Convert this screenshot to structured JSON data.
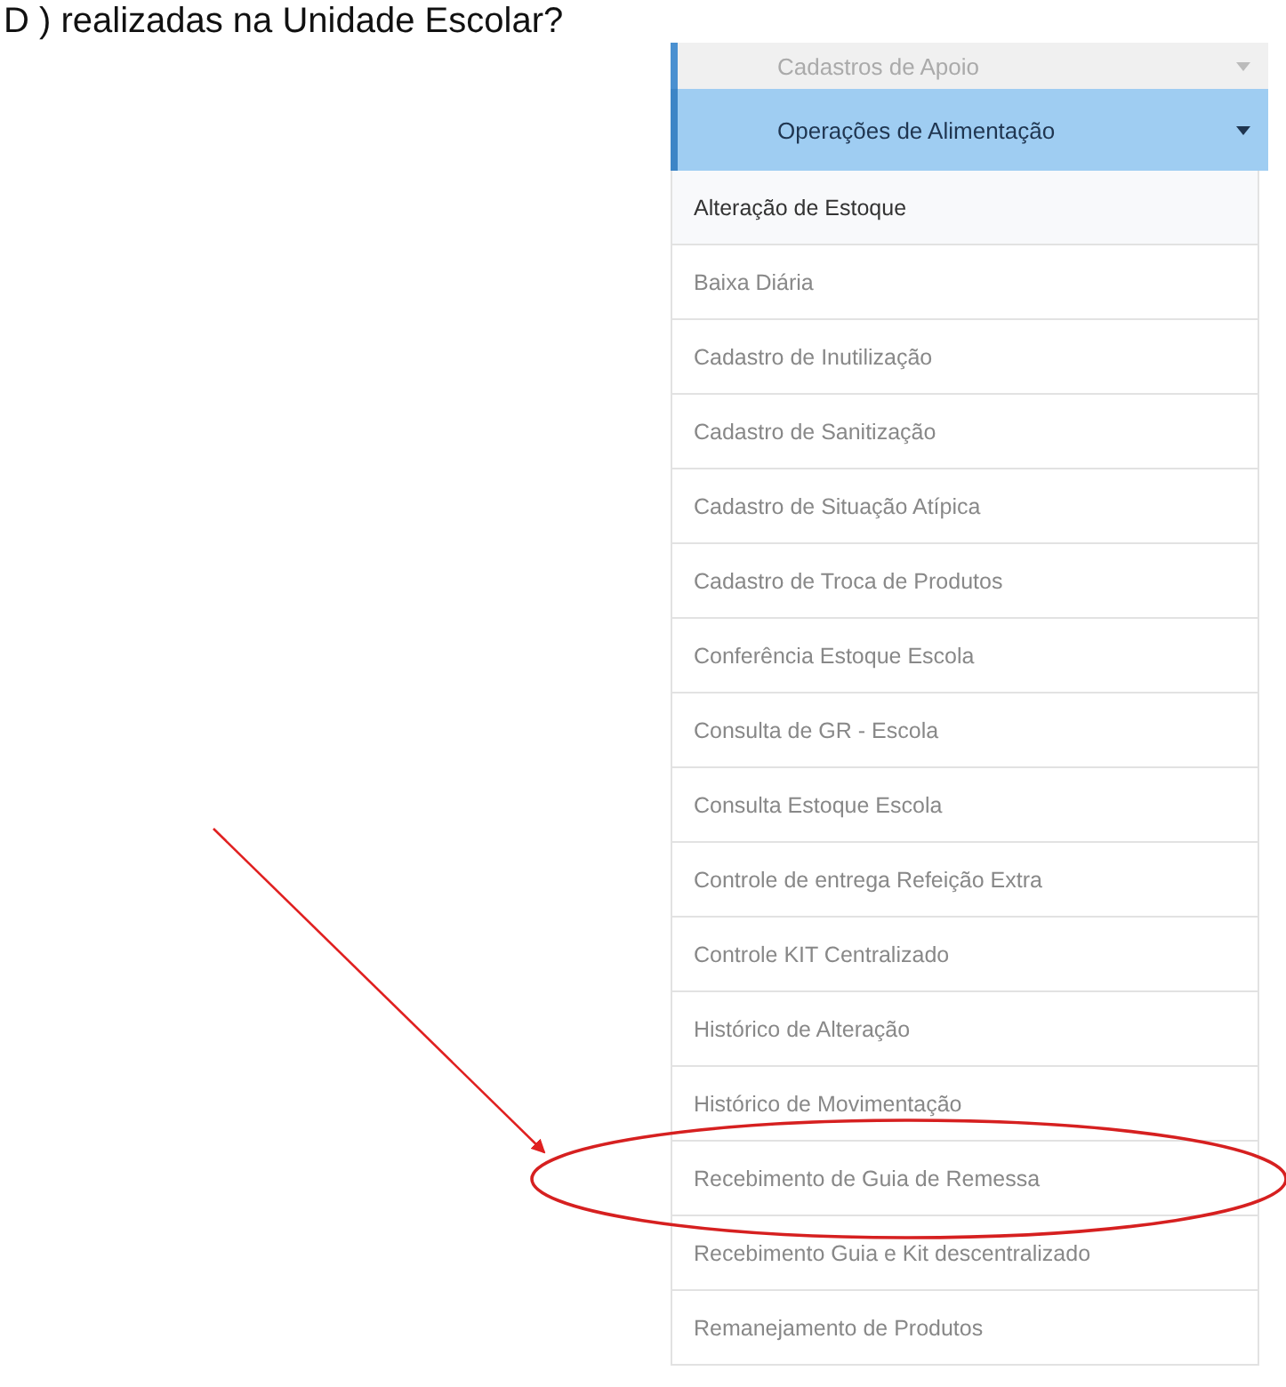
{
  "question": "D ) realizadas na Unidade Escolar?",
  "menu": {
    "sections": [
      {
        "label": "Cadastros de Apoio",
        "selected": false
      },
      {
        "label": "Operações de Alimentação",
        "selected": true,
        "items": [
          {
            "label": "Alteração de Estoque",
            "selected": true
          },
          {
            "label": "Baixa Diária",
            "selected": false
          },
          {
            "label": "Cadastro de Inutilização",
            "selected": false
          },
          {
            "label": "Cadastro de Sanitização",
            "selected": false
          },
          {
            "label": "Cadastro de Situação Atípica",
            "selected": false
          },
          {
            "label": "Cadastro de Troca de Produtos",
            "selected": false
          },
          {
            "label": "Conferência Estoque Escola",
            "selected": false
          },
          {
            "label": "Consulta de GR - Escola",
            "selected": false
          },
          {
            "label": "Consulta Estoque Escola",
            "selected": false
          },
          {
            "label": "Controle de entrega Refeição Extra",
            "selected": false
          },
          {
            "label": "Controle KIT Centralizado",
            "selected": false
          },
          {
            "label": "Histórico de Alteração",
            "selected": false
          },
          {
            "label": "Histórico de Movimentação",
            "selected": false
          },
          {
            "label": "Recebimento de Guia de Remessa",
            "selected": false
          },
          {
            "label": "Recebimento Guia e Kit descentralizado",
            "selected": false
          },
          {
            "label": "Remanejamento de Produtos",
            "selected": false
          }
        ]
      }
    ]
  }
}
